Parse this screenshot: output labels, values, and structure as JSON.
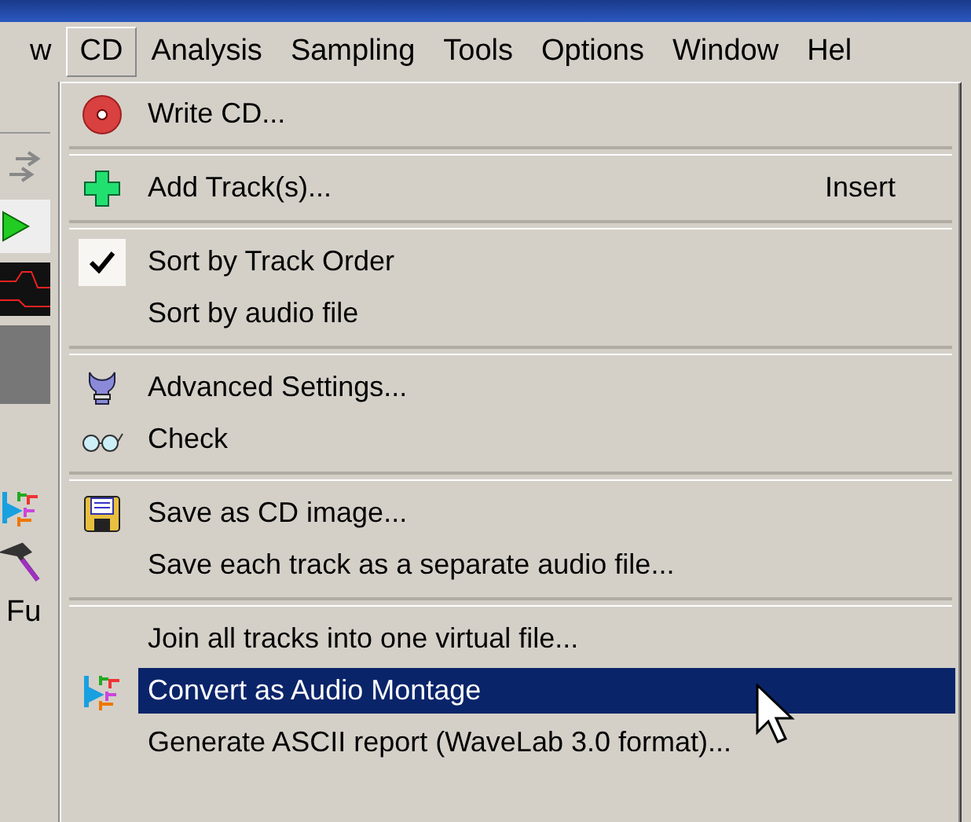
{
  "menu_bar": [
    {
      "label": "w",
      "selected": false
    },
    {
      "label": "CD",
      "selected": true
    },
    {
      "label": "Analysis",
      "selected": false
    },
    {
      "label": "Sampling",
      "selected": false
    },
    {
      "label": "Tools",
      "selected": false
    },
    {
      "label": "Options",
      "selected": false
    },
    {
      "label": "Window",
      "selected": false
    },
    {
      "label": "Hel",
      "selected": false
    }
  ],
  "side_toolbar": {
    "label": "Fu"
  },
  "cd_menu": [
    {
      "kind": "item",
      "label": "Write CD...",
      "selected": false,
      "checked": false
    },
    {
      "kind": "separator"
    },
    {
      "kind": "item",
      "label": "Add Track(s)...",
      "shortcut": "Insert",
      "selected": false,
      "checked": false
    },
    {
      "kind": "separator"
    },
    {
      "kind": "item",
      "label": "Sort by Track Order",
      "selected": false,
      "checked": true
    },
    {
      "kind": "item",
      "label": "Sort by audio file",
      "selected": false,
      "checked": false
    },
    {
      "kind": "separator"
    },
    {
      "kind": "item",
      "label": "Advanced Settings...",
      "selected": false,
      "checked": false
    },
    {
      "kind": "item",
      "label": "Check",
      "selected": false,
      "checked": false
    },
    {
      "kind": "separator"
    },
    {
      "kind": "item",
      "label": "Save as CD image...",
      "selected": false,
      "checked": false
    },
    {
      "kind": "item",
      "label": "Save each track as a separate audio file...",
      "selected": false,
      "checked": false
    },
    {
      "kind": "separator"
    },
    {
      "kind": "item",
      "label": "Join all tracks into one virtual file...",
      "selected": false,
      "checked": false
    },
    {
      "kind": "item",
      "label": "Convert as Audio Montage",
      "selected": true,
      "checked": false
    },
    {
      "kind": "item",
      "label": "Generate ASCII report (WaveLab 3.0 format)...",
      "selected": false,
      "checked": false
    }
  ]
}
